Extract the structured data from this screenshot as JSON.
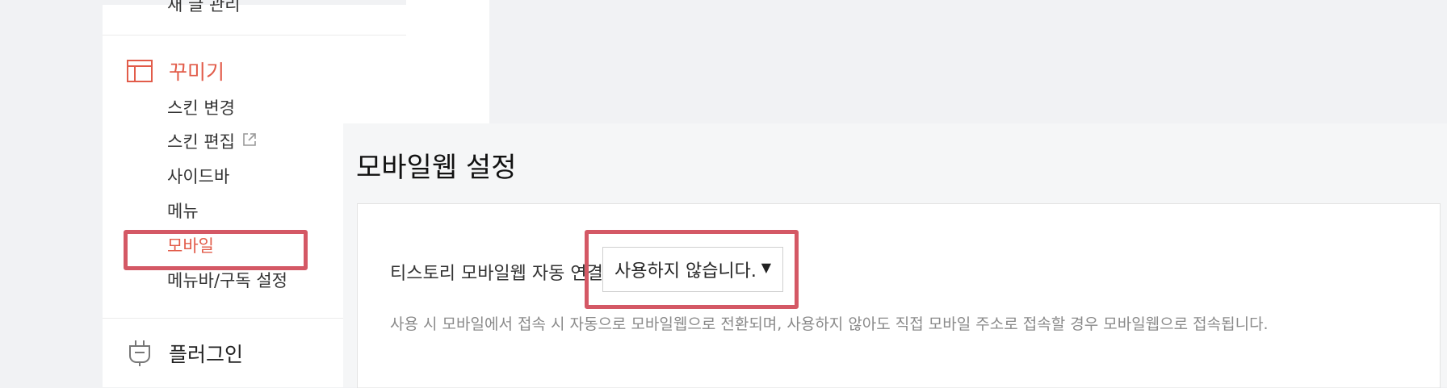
{
  "sidebar": {
    "cut_text": "새 글 관리",
    "sections": {
      "decorate": {
        "title": "꾸미기",
        "icon": "layout-icon",
        "items": [
          {
            "label": "스킨 변경"
          },
          {
            "label": "스킨 편집",
            "icon": "external-link-icon"
          },
          {
            "label": "사이드바"
          },
          {
            "label": "메뉴"
          },
          {
            "label": "모바일",
            "active": true
          },
          {
            "label": "메뉴바/구독 설정"
          }
        ]
      },
      "plugin": {
        "title": "플러그인",
        "icon": "plug-icon"
      }
    }
  },
  "main": {
    "page_title": "모바일웹 설정",
    "setting": {
      "label": "티스토리 모바일웹 자동 연결을",
      "selected_value": "사용하지 않습니다.",
      "help_text": "사용 시 모바일에서 접속 시 자동으로 모바일웹으로 전환되며, 사용하지 않아도 직접 모바일 주소로 접속할 경우 모바일웹으로 접속됩니다."
    }
  },
  "colors": {
    "accent": "#e25c4a",
    "highlight": "#d45865",
    "background": "#f1f2f4"
  }
}
